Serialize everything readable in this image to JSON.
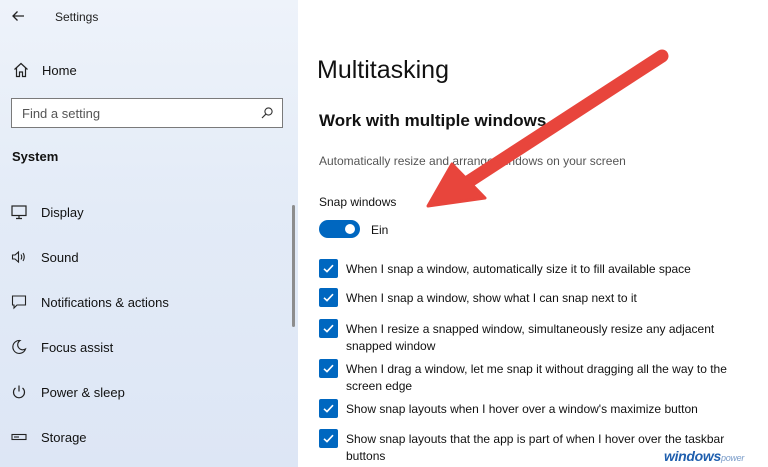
{
  "window": {
    "title": "Settings",
    "back_icon": "back-arrow-icon"
  },
  "sidebar": {
    "home_label": "Home",
    "search_placeholder": "Find a setting",
    "section_label": "System",
    "items": [
      {
        "label": "Display",
        "icon": "display-icon"
      },
      {
        "label": "Sound",
        "icon": "sound-icon"
      },
      {
        "label": "Notifications & actions",
        "icon": "notifications-icon"
      },
      {
        "label": "Focus assist",
        "icon": "focus-assist-icon"
      },
      {
        "label": "Power & sleep",
        "icon": "power-icon"
      },
      {
        "label": "Storage",
        "icon": "storage-icon"
      }
    ]
  },
  "main": {
    "title": "Multitasking",
    "subtitle": "Work with multiple windows",
    "description": "Automatically resize and arrange windows on your screen",
    "snap_label": "Snap windows",
    "snap_state": "Ein",
    "snap_enabled": true,
    "options": [
      {
        "label": "When I snap a window, automatically size it to fill available space",
        "checked": true
      },
      {
        "label": "When I snap a window, show what I can snap next to it",
        "checked": true
      },
      {
        "label": "When I resize a snapped window, simultaneously resize any adjacent snapped window",
        "checked": true
      },
      {
        "label": "When I drag a window, let me snap it without dragging all the way to the screen edge",
        "checked": true
      },
      {
        "label": "Show snap layouts when I hover over a window's maximize button",
        "checked": true
      },
      {
        "label": "Show snap layouts that the app is part of when I hover over the taskbar buttons",
        "checked": true
      }
    ]
  },
  "colors": {
    "accent": "#0067c0",
    "annotation_arrow": "#e8453c"
  },
  "watermark": {
    "main": "windows",
    "suffix": "power"
  }
}
